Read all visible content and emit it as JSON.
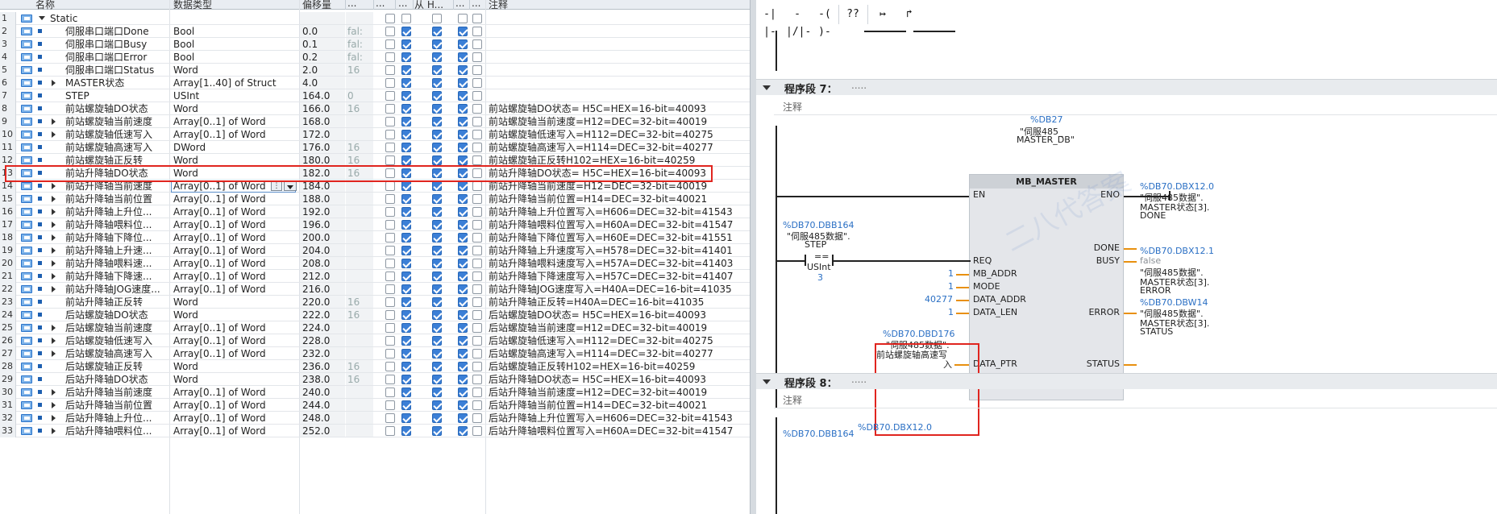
{
  "table": {
    "headers": {
      "name": "名称",
      "type": "数据类型",
      "offset": "偏移量",
      "c1": "...",
      "c2": "...",
      "c3": "...",
      "c4": "从 H...",
      "c5": "...",
      "c6": "...",
      "comment": "注释"
    },
    "rows": [
      {
        "n": "1",
        "name": "Static",
        "type": "",
        "off": "",
        "def": "",
        "cmt": "",
        "exp": "down",
        "st": true,
        "checks": [
          0,
          0,
          0,
          0,
          0
        ]
      },
      {
        "n": "2",
        "name": "伺服串口端口Done",
        "type": "Bool",
        "off": "0.0",
        "def": "fal:",
        "cmt": "",
        "exp": "",
        "checks": [
          0,
          1,
          1,
          1,
          0
        ]
      },
      {
        "n": "3",
        "name": "伺服串口端口Busy",
        "type": "Bool",
        "off": "0.1",
        "def": "fal:",
        "cmt": "",
        "exp": "",
        "checks": [
          0,
          1,
          1,
          1,
          0
        ]
      },
      {
        "n": "4",
        "name": "伺服串口端口Error",
        "type": "Bool",
        "off": "0.2",
        "def": "fal:",
        "cmt": "",
        "exp": "",
        "checks": [
          0,
          1,
          1,
          1,
          0
        ]
      },
      {
        "n": "5",
        "name": "伺服串口端口Status",
        "type": "Word",
        "off": "2.0",
        "def": "16",
        "cmt": "",
        "exp": "",
        "checks": [
          0,
          1,
          1,
          1,
          0
        ]
      },
      {
        "n": "6",
        "name": "MASTER状态",
        "type": "Array[1..40] of Struct",
        "off": "4.0",
        "def": "",
        "cmt": "",
        "exp": "right",
        "checks": [
          0,
          1,
          1,
          1,
          0
        ]
      },
      {
        "n": "7",
        "name": "STEP",
        "type": "USInt",
        "off": "164.0",
        "def": "0",
        "cmt": "",
        "exp": "",
        "checks": [
          0,
          1,
          1,
          1,
          0
        ]
      },
      {
        "n": "8",
        "name": "前站螺旋轴DO状态",
        "type": "Word",
        "off": "166.0",
        "def": "16",
        "cmt": "前站螺旋轴DO状态= H5C=HEX=16-bit=40093",
        "exp": "",
        "checks": [
          0,
          1,
          1,
          1,
          0
        ]
      },
      {
        "n": "9",
        "name": "前站螺旋轴当前速度",
        "type": "Array[0..1] of Word",
        "off": "168.0",
        "def": "",
        "cmt": "前站螺旋轴当前速度=H12=DEC=32-bit=40019",
        "exp": "right",
        "checks": [
          0,
          1,
          1,
          1,
          0
        ]
      },
      {
        "n": "10",
        "name": "前站螺旋轴低速写入",
        "type": "Array[0..1] of Word",
        "off": "172.0",
        "def": "",
        "cmt": "前站螺旋轴低速写入=H112=DEC=32-bit=40275",
        "exp": "right",
        "checks": [
          0,
          1,
          1,
          1,
          0
        ]
      },
      {
        "n": "11",
        "name": "前站螺旋轴高速写入",
        "type": "DWord",
        "off": "176.0",
        "def": "16",
        "cmt": "前站螺旋轴高速写入=H114=DEC=32-bit=40277",
        "exp": "",
        "checks": [
          0,
          1,
          1,
          1,
          0
        ]
      },
      {
        "n": "12",
        "name": "前站螺旋轴正反转",
        "type": "Word",
        "off": "180.0",
        "def": "16",
        "cmt": "前站螺旋轴正反转H102=HEX=16-bit=40259",
        "exp": "",
        "checks": [
          0,
          1,
          1,
          1,
          0
        ]
      },
      {
        "n": "13",
        "name": "前站升降轴DO状态",
        "type": "Word",
        "off": "182.0",
        "def": "16",
        "cmt": "前站升降轴DO状态= H5C=HEX=16-bit=40093",
        "exp": "",
        "checks": [
          0,
          1,
          1,
          1,
          0
        ]
      },
      {
        "n": "14",
        "name": "前站升降轴当前速度",
        "type": "Array[0..1] of Word",
        "off": "184.0",
        "def": "",
        "cmt": "前站升降轴当前速度=H12=DEC=32-bit=40019",
        "exp": "right",
        "checks": [
          0,
          1,
          1,
          1,
          0
        ],
        "dd": true
      },
      {
        "n": "15",
        "name": "前站升降轴当前位置",
        "type": "Array[0..1] of Word",
        "off": "188.0",
        "def": "",
        "cmt": "前站升降轴当前位置=H14=DEC=32-bit=40021",
        "exp": "right",
        "checks": [
          0,
          1,
          1,
          1,
          0
        ]
      },
      {
        "n": "16",
        "name": "前站升降轴上升位...",
        "type": "Array[0..1] of Word",
        "off": "192.0",
        "def": "",
        "cmt": "前站升降轴上升位置写入=H606=DEC=32-bit=41543",
        "exp": "right",
        "checks": [
          0,
          1,
          1,
          1,
          0
        ]
      },
      {
        "n": "17",
        "name": "前站升降轴喂料位...",
        "type": "Array[0..1] of Word",
        "off": "196.0",
        "def": "",
        "cmt": "前站升降轴喂料位置写入=H60A=DEC=32-bit=41547",
        "exp": "right",
        "checks": [
          0,
          1,
          1,
          1,
          0
        ]
      },
      {
        "n": "18",
        "name": "前站升降轴下降位...",
        "type": "Array[0..1] of Word",
        "off": "200.0",
        "def": "",
        "cmt": "前站升降轴下降位置写入=H60E=DEC=32-bit=41551",
        "exp": "right",
        "checks": [
          0,
          1,
          1,
          1,
          0
        ]
      },
      {
        "n": "19",
        "name": "前站升降轴上升速...",
        "type": "Array[0..1] of Word",
        "off": "204.0",
        "def": "",
        "cmt": "前站升降轴上升速度写入=H578=DEC=32-bit=41401",
        "exp": "right",
        "checks": [
          0,
          1,
          1,
          1,
          0
        ]
      },
      {
        "n": "20",
        "name": "前站升降轴喂料速...",
        "type": "Array[0..1] of Word",
        "off": "208.0",
        "def": "",
        "cmt": "前站升降轴喂料速度写入=H57A=DEC=32-bit=41403",
        "exp": "right",
        "checks": [
          0,
          1,
          1,
          1,
          0
        ]
      },
      {
        "n": "21",
        "name": "前站升降轴下降速...",
        "type": "Array[0..1] of Word",
        "off": "212.0",
        "def": "",
        "cmt": "前站升降轴下降速度写入=H57C=DEC=32-bit=41407",
        "exp": "right",
        "checks": [
          0,
          1,
          1,
          1,
          0
        ]
      },
      {
        "n": "22",
        "name": "前站升降轴JOG速度...",
        "type": "Array[0..1] of Word",
        "off": "216.0",
        "def": "",
        "cmt": "前站升降轴JOG速度写入=H40A=DEC=16-bit=41035",
        "exp": "right",
        "checks": [
          0,
          1,
          1,
          1,
          0
        ]
      },
      {
        "n": "23",
        "name": "前站升降轴正反转",
        "type": "Word",
        "off": "220.0",
        "def": "16",
        "cmt": "前站升降轴正反转=H40A=DEC=16-bit=41035",
        "exp": "",
        "checks": [
          0,
          1,
          1,
          1,
          0
        ]
      },
      {
        "n": "24",
        "name": "后站螺旋轴DO状态",
        "type": "Word",
        "off": "222.0",
        "def": "16",
        "cmt": "后站螺旋轴DO状态= H5C=HEX=16-bit=40093",
        "exp": "",
        "checks": [
          0,
          1,
          1,
          1,
          0
        ]
      },
      {
        "n": "25",
        "name": "后站螺旋轴当前速度",
        "type": "Array[0..1] of Word",
        "off": "224.0",
        "def": "",
        "cmt": "后站螺旋轴当前速度=H12=DEC=32-bit=40019",
        "exp": "right",
        "checks": [
          0,
          1,
          1,
          1,
          0
        ]
      },
      {
        "n": "26",
        "name": "后站螺旋轴低速写入",
        "type": "Array[0..1] of Word",
        "off": "228.0",
        "def": "",
        "cmt": "后站螺旋轴低速写入=H112=DEC=32-bit=40275",
        "exp": "right",
        "checks": [
          0,
          1,
          1,
          1,
          0
        ]
      },
      {
        "n": "27",
        "name": "后站螺旋轴高速写入",
        "type": "Array[0..1] of Word",
        "off": "232.0",
        "def": "",
        "cmt": "后站螺旋轴高速写入=H114=DEC=32-bit=40277",
        "exp": "right",
        "checks": [
          0,
          1,
          1,
          1,
          0
        ]
      },
      {
        "n": "28",
        "name": "后站螺旋轴正反转",
        "type": "Word",
        "off": "236.0",
        "def": "16",
        "cmt": "后站螺旋轴正反转H102=HEX=16-bit=40259",
        "exp": "",
        "checks": [
          0,
          1,
          1,
          1,
          0
        ]
      },
      {
        "n": "29",
        "name": "后站升降轴DO状态",
        "type": "Word",
        "off": "238.0",
        "def": "16",
        "cmt": "后站升降轴DO状态= H5C=HEX=16-bit=40093",
        "exp": "",
        "checks": [
          0,
          1,
          1,
          1,
          0
        ]
      },
      {
        "n": "30",
        "name": "后站升降轴当前速度",
        "type": "Array[0..1] of Word",
        "off": "240.0",
        "def": "",
        "cmt": "后站升降轴当前速度=H12=DEC=32-bit=40019",
        "exp": "right",
        "checks": [
          0,
          1,
          1,
          1,
          0
        ]
      },
      {
        "n": "31",
        "name": "后站升降轴当前位置",
        "type": "Array[0..1] of Word",
        "off": "244.0",
        "def": "",
        "cmt": "后站升降轴当前位置=H14=DEC=32-bit=40021",
        "exp": "right",
        "checks": [
          0,
          1,
          1,
          1,
          0
        ]
      },
      {
        "n": "32",
        "name": "后站升降轴上升位...",
        "type": "Array[0..1] of Word",
        "off": "248.0",
        "def": "",
        "cmt": "后站升降轴上升位置写入=H606=DEC=32-bit=41543",
        "exp": "right",
        "checks": [
          0,
          1,
          1,
          1,
          0
        ]
      },
      {
        "n": "33",
        "name": "后站升降轴喂料位...",
        "type": "Array[0..1] of Word",
        "off": "252.0",
        "def": "",
        "cmt": "后站升降轴喂料位置写入=H60A=DEC=32-bit=41547",
        "exp": "right",
        "checks": [
          0,
          1,
          1,
          1,
          0
        ]
      }
    ]
  },
  "toolbar": {
    "items": [
      "-| |-",
      "-|/|-",
      "-( )-",
      "??",
      "↦",
      "↱"
    ]
  },
  "lad": {
    "network7": {
      "label": "程序段 7：",
      "dots": "....."
    },
    "network8": {
      "label": "程序段 8：",
      "dots": "....."
    },
    "comment": "注释",
    "db_name": "%DB27",
    "db_comment": "\"伺服485_MASTER_DB\"",
    "db_comment_l1": "\"伺服485_",
    "db_comment_l2": "MASTER_DB\"",
    "fb_title": "MB_MASTER",
    "pins": {
      "en": "EN",
      "eno": "ENO",
      "req": "REQ",
      "mb_addr": "MB_ADDR",
      "mode": "MODE",
      "data_addr": "DATA_ADDR",
      "data_len": "DATA_LEN",
      "data_ptr": "DATA_PTR",
      "done": "DONE",
      "busy": "BUSY",
      "error": "ERROR",
      "status": "STATUS"
    },
    "vals": {
      "mb_addr": "1",
      "mode": "1",
      "data_addr": "40277",
      "data_len": "1",
      "busy": "false"
    },
    "step": {
      "addr": "%DB70.DBB164",
      "name_l1": "\"伺服485数据\".",
      "name_l2": "STEP",
      "op": "==",
      "type": "USInt",
      "val": "3"
    },
    "ptr": {
      "addr": "%DB70.DBD176",
      "name_l1": "\"伺服485数据\".",
      "name_l2": "前站螺旋轴高速写",
      "name_l3": "入"
    },
    "done_out": {
      "addr": "%DB70.DBX12.0",
      "l1": "\"伺服485数据\".",
      "l2": "MASTER状态[3].",
      "l3": "DONE"
    },
    "err_out": {
      "addr": "%DB70.DBX12.1",
      "l1": "\"伺服485数据\".",
      "l2": "MASTER状态[3].",
      "l3": "ERROR"
    },
    "status_out": {
      "addr": "%DB70.DBW14",
      "l1": "\"伺服485数据\".",
      "l2": "MASTER状态[3].",
      "l3": "STATUS"
    },
    "bottom": {
      "a1": "%DB70.DBB164",
      "a2": "%DB70.DBX12.0"
    },
    "watermark": "二八代答案"
  },
  "colors": {
    "highlight": "#e0251f",
    "blue": "#2a6fc4",
    "wire_orange": "#e8900f"
  }
}
